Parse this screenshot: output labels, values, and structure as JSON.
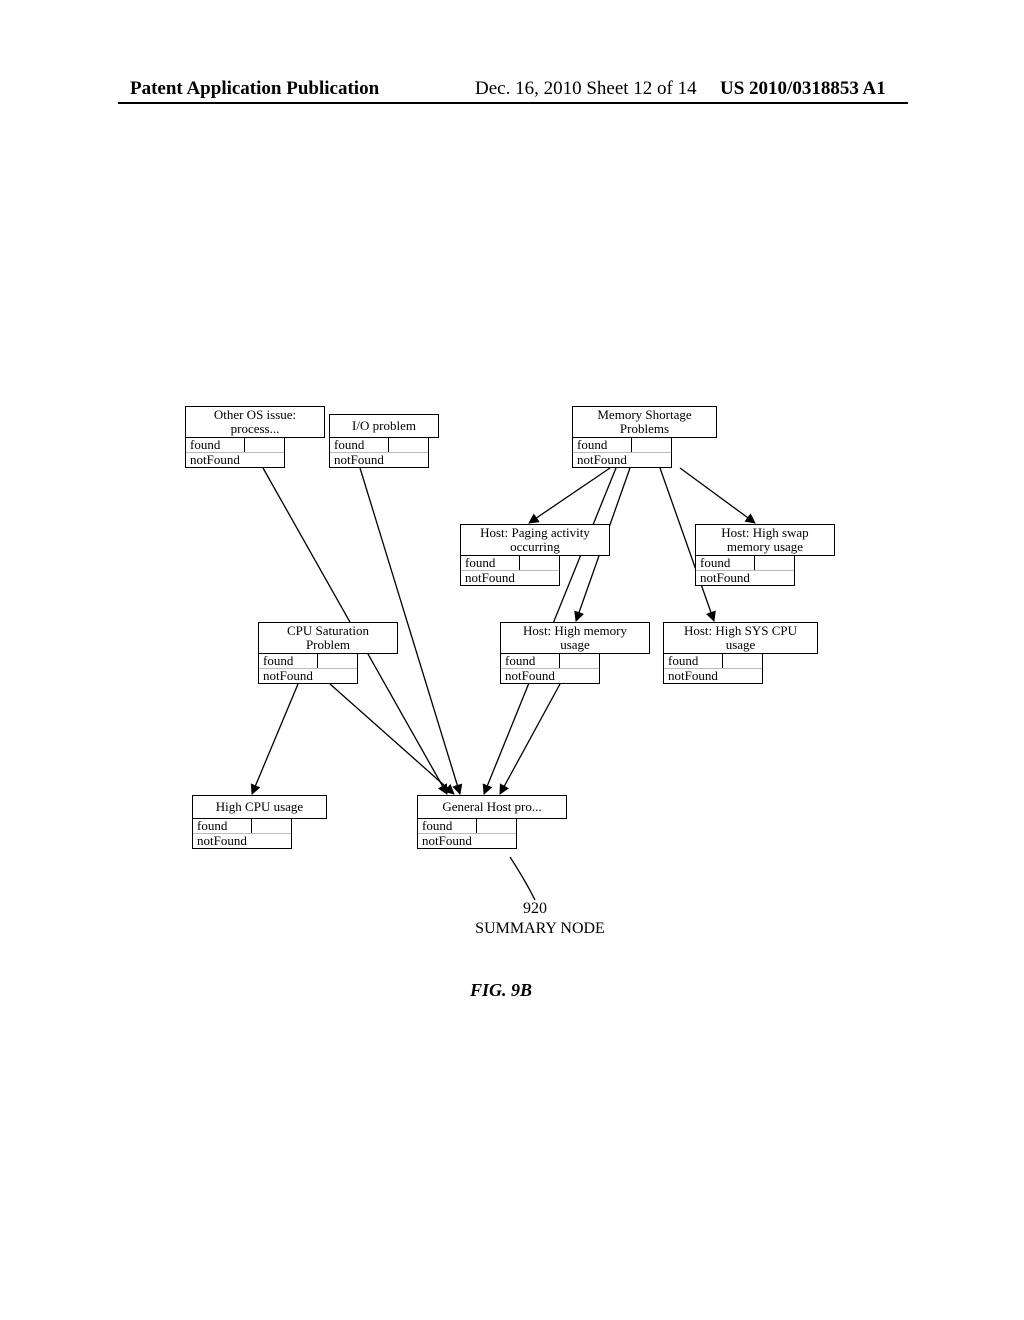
{
  "header": {
    "left": "Patent Application Publication",
    "mid": "Dec. 16, 2010   Sheet 12 of 14",
    "right": "US 2010/0318853 A1"
  },
  "nodes": {
    "otherOS": {
      "title": "Other OS issue:\nprocess...",
      "found": "found",
      "notFound": "notFound"
    },
    "io": {
      "title": "I/O problem",
      "found": "found",
      "notFound": "notFound"
    },
    "memShort": {
      "title": "Memory Shortage\nProblems",
      "found": "found",
      "notFound": "notFound"
    },
    "paging": {
      "title": "Host: Paging activity\noccurring",
      "found": "found",
      "notFound": "notFound"
    },
    "swap": {
      "title": "Host: High swap\nmemory usage",
      "found": "found",
      "notFound": "notFound"
    },
    "cpuSat": {
      "title": "CPU Saturation\nProblem",
      "found": "found",
      "notFound": "notFound"
    },
    "highMem": {
      "title": "Host: High memory\nusage",
      "found": "found",
      "notFound": "notFound"
    },
    "highSys": {
      "title": "Host: High SYS CPU\nusage",
      "found": "found",
      "notFound": "notFound"
    },
    "highCPU": {
      "title": "High CPU usage",
      "found": "found",
      "notFound": "notFound"
    },
    "general": {
      "title": "General Host pro...",
      "found": "found",
      "notFound": "notFound"
    }
  },
  "callout": {
    "ref": "920",
    "label": "SUMMARY NODE"
  },
  "figure": "FIG. 9B"
}
